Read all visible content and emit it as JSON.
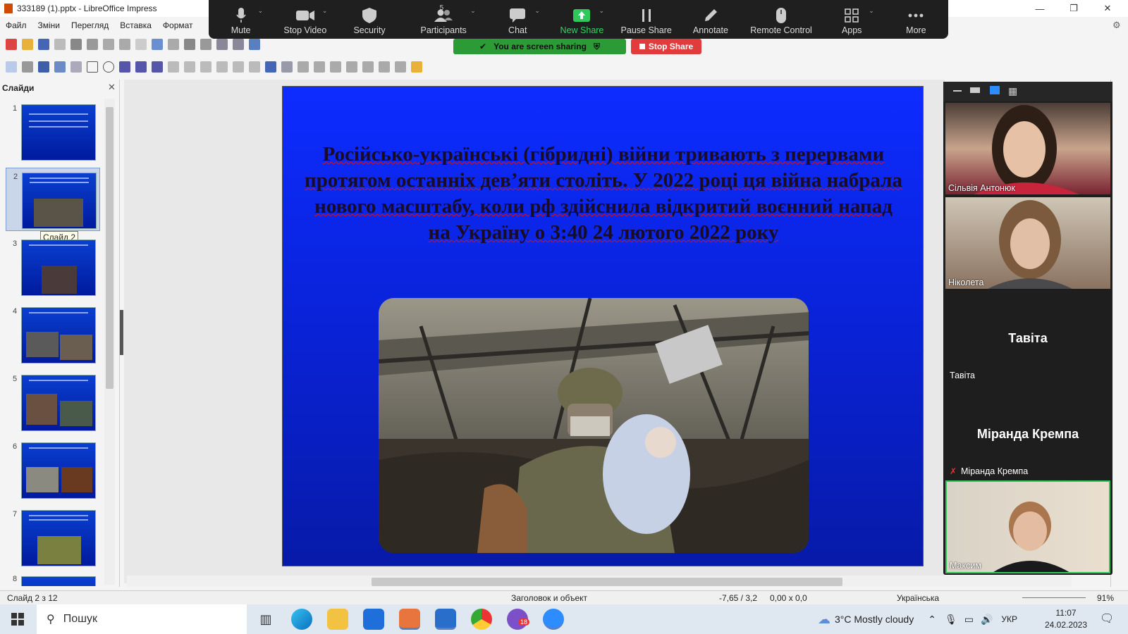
{
  "window": {
    "title": "333189 (1).pptx - LibreOffice Impress"
  },
  "menu": [
    "Файл",
    "Зміни",
    "Перегляд",
    "Вставка",
    "Формат"
  ],
  "zoom_toolbar": {
    "items": [
      {
        "label": "Mute",
        "icon": "microphone-icon"
      },
      {
        "label": "Stop Video",
        "icon": "video-camera-icon"
      },
      {
        "label": "Security",
        "icon": "shield-icon"
      },
      {
        "label": "Participants",
        "icon": "participants-icon",
        "count": "5"
      },
      {
        "label": "Chat",
        "icon": "chat-bubble-icon"
      },
      {
        "label": "New Share",
        "icon": "share-arrow-icon"
      },
      {
        "label": "Pause Share",
        "icon": "pause-icon"
      },
      {
        "label": "Annotate",
        "icon": "pencil-icon"
      },
      {
        "label": "Remote Control",
        "icon": "mouse-icon"
      },
      {
        "label": "Apps",
        "icon": "apps-icon"
      },
      {
        "label": "More",
        "icon": "more-dots-icon"
      }
    ],
    "sharing_banner": "You are screen sharing",
    "stop_share": "Stop Share"
  },
  "slide_pane": {
    "title": "Слайди",
    "tooltip": "Слайд 2",
    "thumbnails": [
      "1",
      "2",
      "3",
      "4",
      "5",
      "6",
      "7",
      "8"
    ],
    "selected": 2
  },
  "slide": {
    "title": "Російсько-українські (гібридні) війни тривають з перервами протягом останніх дев’яти століть. У 2022 році ця війна набрала нового масштабу, коли рф здійснила відкритий воєнний напад на Україну о 3:40 24 лютого 2022 року",
    "image_alt": "soldier-carrying-infant-photo"
  },
  "participants": [
    {
      "name": "Сільвія Антонюк",
      "type": "video"
    },
    {
      "name": "Ніколета",
      "type": "video"
    },
    {
      "name": "Тавіта",
      "display_name": "Тавіта ",
      "type": "name"
    },
    {
      "name": "Міранда Кремпа",
      "display_name": "Міранда Кремпа",
      "type": "name",
      "muted": true
    },
    {
      "name": "Максим",
      "type": "video"
    }
  ],
  "statusbar": {
    "slide": "Слайд 2 з 12",
    "layout": "Заголовок и объект",
    "position": "-7,65 / 3,2",
    "size": "0,00 x 0,0",
    "language": "Українська",
    "zoom": "91%"
  },
  "taskbar": {
    "search": "Пошук",
    "weather": "3°C  Mostly cloudy",
    "lang": "УКР",
    "time": "11:07",
    "date": "24.02.2023",
    "viber_badge": "18"
  },
  "colors": {
    "slide_bg": "#0d2cff",
    "zoom_bar": "#1f1f1f",
    "share_green": "#2a9b35",
    "stop_red": "#e23b3b"
  }
}
